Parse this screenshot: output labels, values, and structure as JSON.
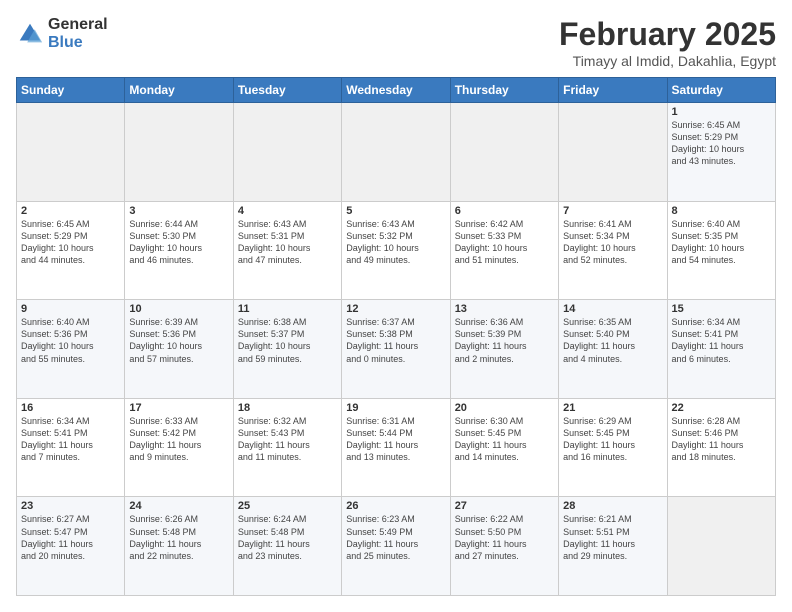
{
  "logo": {
    "general": "General",
    "blue": "Blue"
  },
  "title": "February 2025",
  "location": "Timayy al Imdid, Dakahlia, Egypt",
  "days_of_week": [
    "Sunday",
    "Monday",
    "Tuesday",
    "Wednesday",
    "Thursday",
    "Friday",
    "Saturday"
  ],
  "weeks": [
    [
      {
        "day": "",
        "info": ""
      },
      {
        "day": "",
        "info": ""
      },
      {
        "day": "",
        "info": ""
      },
      {
        "day": "",
        "info": ""
      },
      {
        "day": "",
        "info": ""
      },
      {
        "day": "",
        "info": ""
      },
      {
        "day": "1",
        "info": "Sunrise: 6:45 AM\nSunset: 5:29 PM\nDaylight: 10 hours\nand 43 minutes."
      }
    ],
    [
      {
        "day": "2",
        "info": "Sunrise: 6:45 AM\nSunset: 5:29 PM\nDaylight: 10 hours\nand 44 minutes."
      },
      {
        "day": "3",
        "info": "Sunrise: 6:44 AM\nSunset: 5:30 PM\nDaylight: 10 hours\nand 46 minutes."
      },
      {
        "day": "4",
        "info": "Sunrise: 6:43 AM\nSunset: 5:31 PM\nDaylight: 10 hours\nand 47 minutes."
      },
      {
        "day": "5",
        "info": "Sunrise: 6:43 AM\nSunset: 5:32 PM\nDaylight: 10 hours\nand 49 minutes."
      },
      {
        "day": "6",
        "info": "Sunrise: 6:42 AM\nSunset: 5:33 PM\nDaylight: 10 hours\nand 51 minutes."
      },
      {
        "day": "7",
        "info": "Sunrise: 6:41 AM\nSunset: 5:34 PM\nDaylight: 10 hours\nand 52 minutes."
      },
      {
        "day": "8",
        "info": "Sunrise: 6:40 AM\nSunset: 5:35 PM\nDaylight: 10 hours\nand 54 minutes."
      }
    ],
    [
      {
        "day": "9",
        "info": "Sunrise: 6:40 AM\nSunset: 5:36 PM\nDaylight: 10 hours\nand 55 minutes."
      },
      {
        "day": "10",
        "info": "Sunrise: 6:39 AM\nSunset: 5:36 PM\nDaylight: 10 hours\nand 57 minutes."
      },
      {
        "day": "11",
        "info": "Sunrise: 6:38 AM\nSunset: 5:37 PM\nDaylight: 10 hours\nand 59 minutes."
      },
      {
        "day": "12",
        "info": "Sunrise: 6:37 AM\nSunset: 5:38 PM\nDaylight: 11 hours\nand 0 minutes."
      },
      {
        "day": "13",
        "info": "Sunrise: 6:36 AM\nSunset: 5:39 PM\nDaylight: 11 hours\nand 2 minutes."
      },
      {
        "day": "14",
        "info": "Sunrise: 6:35 AM\nSunset: 5:40 PM\nDaylight: 11 hours\nand 4 minutes."
      },
      {
        "day": "15",
        "info": "Sunrise: 6:34 AM\nSunset: 5:41 PM\nDaylight: 11 hours\nand 6 minutes."
      }
    ],
    [
      {
        "day": "16",
        "info": "Sunrise: 6:34 AM\nSunset: 5:41 PM\nDaylight: 11 hours\nand 7 minutes."
      },
      {
        "day": "17",
        "info": "Sunrise: 6:33 AM\nSunset: 5:42 PM\nDaylight: 11 hours\nand 9 minutes."
      },
      {
        "day": "18",
        "info": "Sunrise: 6:32 AM\nSunset: 5:43 PM\nDaylight: 11 hours\nand 11 minutes."
      },
      {
        "day": "19",
        "info": "Sunrise: 6:31 AM\nSunset: 5:44 PM\nDaylight: 11 hours\nand 13 minutes."
      },
      {
        "day": "20",
        "info": "Sunrise: 6:30 AM\nSunset: 5:45 PM\nDaylight: 11 hours\nand 14 minutes."
      },
      {
        "day": "21",
        "info": "Sunrise: 6:29 AM\nSunset: 5:45 PM\nDaylight: 11 hours\nand 16 minutes."
      },
      {
        "day": "22",
        "info": "Sunrise: 6:28 AM\nSunset: 5:46 PM\nDaylight: 11 hours\nand 18 minutes."
      }
    ],
    [
      {
        "day": "23",
        "info": "Sunrise: 6:27 AM\nSunset: 5:47 PM\nDaylight: 11 hours\nand 20 minutes."
      },
      {
        "day": "24",
        "info": "Sunrise: 6:26 AM\nSunset: 5:48 PM\nDaylight: 11 hours\nand 22 minutes."
      },
      {
        "day": "25",
        "info": "Sunrise: 6:24 AM\nSunset: 5:48 PM\nDaylight: 11 hours\nand 23 minutes."
      },
      {
        "day": "26",
        "info": "Sunrise: 6:23 AM\nSunset: 5:49 PM\nDaylight: 11 hours\nand 25 minutes."
      },
      {
        "day": "27",
        "info": "Sunrise: 6:22 AM\nSunset: 5:50 PM\nDaylight: 11 hours\nand 27 minutes."
      },
      {
        "day": "28",
        "info": "Sunrise: 6:21 AM\nSunset: 5:51 PM\nDaylight: 11 hours\nand 29 minutes."
      },
      {
        "day": "",
        "info": ""
      }
    ]
  ]
}
